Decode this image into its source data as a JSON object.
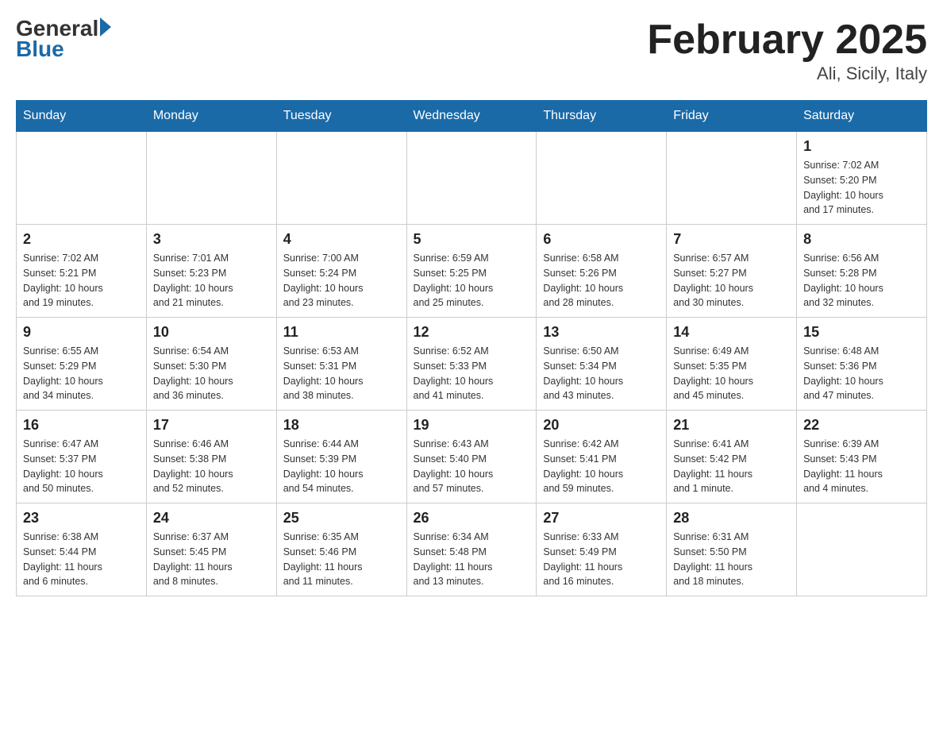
{
  "header": {
    "logo_general": "General",
    "logo_blue": "Blue",
    "month_title": "February 2025",
    "location": "Ali, Sicily, Italy"
  },
  "weekdays": [
    "Sunday",
    "Monday",
    "Tuesday",
    "Wednesday",
    "Thursday",
    "Friday",
    "Saturday"
  ],
  "weeks": [
    [
      {
        "day": "",
        "info": ""
      },
      {
        "day": "",
        "info": ""
      },
      {
        "day": "",
        "info": ""
      },
      {
        "day": "",
        "info": ""
      },
      {
        "day": "",
        "info": ""
      },
      {
        "day": "",
        "info": ""
      },
      {
        "day": "1",
        "info": "Sunrise: 7:02 AM\nSunset: 5:20 PM\nDaylight: 10 hours\nand 17 minutes."
      }
    ],
    [
      {
        "day": "2",
        "info": "Sunrise: 7:02 AM\nSunset: 5:21 PM\nDaylight: 10 hours\nand 19 minutes."
      },
      {
        "day": "3",
        "info": "Sunrise: 7:01 AM\nSunset: 5:23 PM\nDaylight: 10 hours\nand 21 minutes."
      },
      {
        "day": "4",
        "info": "Sunrise: 7:00 AM\nSunset: 5:24 PM\nDaylight: 10 hours\nand 23 minutes."
      },
      {
        "day": "5",
        "info": "Sunrise: 6:59 AM\nSunset: 5:25 PM\nDaylight: 10 hours\nand 25 minutes."
      },
      {
        "day": "6",
        "info": "Sunrise: 6:58 AM\nSunset: 5:26 PM\nDaylight: 10 hours\nand 28 minutes."
      },
      {
        "day": "7",
        "info": "Sunrise: 6:57 AM\nSunset: 5:27 PM\nDaylight: 10 hours\nand 30 minutes."
      },
      {
        "day": "8",
        "info": "Sunrise: 6:56 AM\nSunset: 5:28 PM\nDaylight: 10 hours\nand 32 minutes."
      }
    ],
    [
      {
        "day": "9",
        "info": "Sunrise: 6:55 AM\nSunset: 5:29 PM\nDaylight: 10 hours\nand 34 minutes."
      },
      {
        "day": "10",
        "info": "Sunrise: 6:54 AM\nSunset: 5:30 PM\nDaylight: 10 hours\nand 36 minutes."
      },
      {
        "day": "11",
        "info": "Sunrise: 6:53 AM\nSunset: 5:31 PM\nDaylight: 10 hours\nand 38 minutes."
      },
      {
        "day": "12",
        "info": "Sunrise: 6:52 AM\nSunset: 5:33 PM\nDaylight: 10 hours\nand 41 minutes."
      },
      {
        "day": "13",
        "info": "Sunrise: 6:50 AM\nSunset: 5:34 PM\nDaylight: 10 hours\nand 43 minutes."
      },
      {
        "day": "14",
        "info": "Sunrise: 6:49 AM\nSunset: 5:35 PM\nDaylight: 10 hours\nand 45 minutes."
      },
      {
        "day": "15",
        "info": "Sunrise: 6:48 AM\nSunset: 5:36 PM\nDaylight: 10 hours\nand 47 minutes."
      }
    ],
    [
      {
        "day": "16",
        "info": "Sunrise: 6:47 AM\nSunset: 5:37 PM\nDaylight: 10 hours\nand 50 minutes."
      },
      {
        "day": "17",
        "info": "Sunrise: 6:46 AM\nSunset: 5:38 PM\nDaylight: 10 hours\nand 52 minutes."
      },
      {
        "day": "18",
        "info": "Sunrise: 6:44 AM\nSunset: 5:39 PM\nDaylight: 10 hours\nand 54 minutes."
      },
      {
        "day": "19",
        "info": "Sunrise: 6:43 AM\nSunset: 5:40 PM\nDaylight: 10 hours\nand 57 minutes."
      },
      {
        "day": "20",
        "info": "Sunrise: 6:42 AM\nSunset: 5:41 PM\nDaylight: 10 hours\nand 59 minutes."
      },
      {
        "day": "21",
        "info": "Sunrise: 6:41 AM\nSunset: 5:42 PM\nDaylight: 11 hours\nand 1 minute."
      },
      {
        "day": "22",
        "info": "Sunrise: 6:39 AM\nSunset: 5:43 PM\nDaylight: 11 hours\nand 4 minutes."
      }
    ],
    [
      {
        "day": "23",
        "info": "Sunrise: 6:38 AM\nSunset: 5:44 PM\nDaylight: 11 hours\nand 6 minutes."
      },
      {
        "day": "24",
        "info": "Sunrise: 6:37 AM\nSunset: 5:45 PM\nDaylight: 11 hours\nand 8 minutes."
      },
      {
        "day": "25",
        "info": "Sunrise: 6:35 AM\nSunset: 5:46 PM\nDaylight: 11 hours\nand 11 minutes."
      },
      {
        "day": "26",
        "info": "Sunrise: 6:34 AM\nSunset: 5:48 PM\nDaylight: 11 hours\nand 13 minutes."
      },
      {
        "day": "27",
        "info": "Sunrise: 6:33 AM\nSunset: 5:49 PM\nDaylight: 11 hours\nand 16 minutes."
      },
      {
        "day": "28",
        "info": "Sunrise: 6:31 AM\nSunset: 5:50 PM\nDaylight: 11 hours\nand 18 minutes."
      },
      {
        "day": "",
        "info": ""
      }
    ]
  ]
}
